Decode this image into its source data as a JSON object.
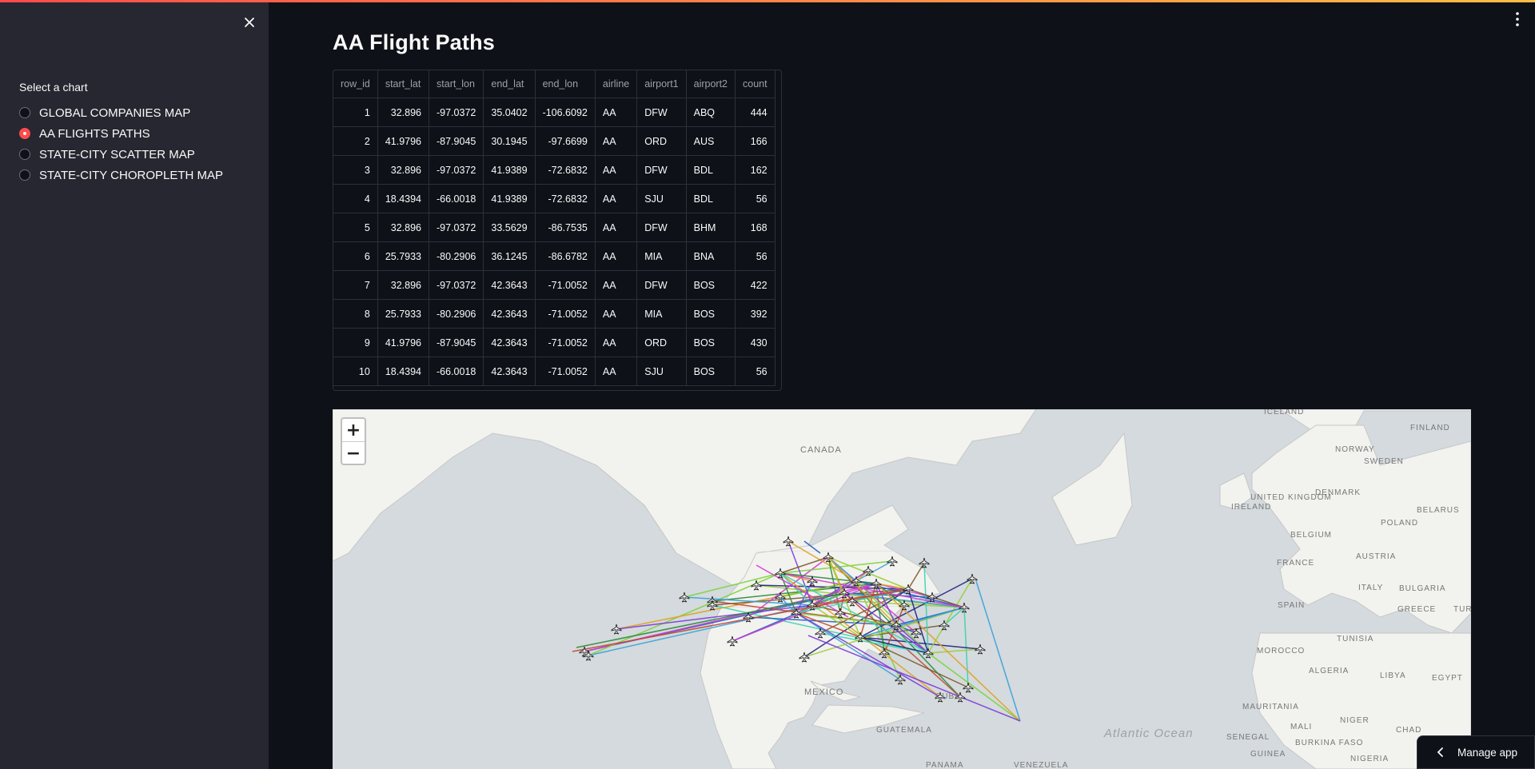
{
  "sidebar": {
    "close_icon": "close-icon",
    "label": "Select a chart",
    "options": [
      "GLOBAL COMPANIES MAP",
      "AA FLIGHTS PATHS",
      "STATE-CITY SCATTER MAP",
      "STATE-CITY CHOROPLETH MAP"
    ],
    "selected": "AA FLIGHTS PATHS"
  },
  "main": {
    "menu_icon": "kebab-menu-icon",
    "title": "AA Flight Paths"
  },
  "table": {
    "columns": [
      "row_id",
      "start_lat",
      "start_lon",
      "end_lat",
      "end_lon",
      "airline",
      "airport1",
      "airport2",
      "count"
    ],
    "rows": [
      [
        "1",
        "32.896",
        "-97.0372",
        "35.0402",
        "-106.6092",
        "AA",
        "DFW",
        "ABQ",
        "444"
      ],
      [
        "2",
        "41.9796",
        "-87.9045",
        "30.1945",
        "-97.6699",
        "AA",
        "ORD",
        "AUS",
        "166"
      ],
      [
        "3",
        "32.896",
        "-97.0372",
        "41.9389",
        "-72.6832",
        "AA",
        "DFW",
        "BDL",
        "162"
      ],
      [
        "4",
        "18.4394",
        "-66.0018",
        "41.9389",
        "-72.6832",
        "AA",
        "SJU",
        "BDL",
        "56"
      ],
      [
        "5",
        "32.896",
        "-97.0372",
        "33.5629",
        "-86.7535",
        "AA",
        "DFW",
        "BHM",
        "168"
      ],
      [
        "6",
        "25.7933",
        "-80.2906",
        "36.1245",
        "-86.6782",
        "AA",
        "MIA",
        "BNA",
        "56"
      ],
      [
        "7",
        "32.896",
        "-97.0372",
        "42.3643",
        "-71.0052",
        "AA",
        "DFW",
        "BOS",
        "422"
      ],
      [
        "8",
        "25.7933",
        "-80.2906",
        "42.3643",
        "-71.0052",
        "AA",
        "MIA",
        "BOS",
        "392"
      ],
      [
        "9",
        "41.9796",
        "-87.9045",
        "42.3643",
        "-71.0052",
        "AA",
        "ORD",
        "BOS",
        "430"
      ],
      [
        "10",
        "18.4394",
        "-66.0018",
        "42.3643",
        "-71.0052",
        "AA",
        "SJU",
        "BOS",
        "56"
      ]
    ]
  },
  "map": {
    "zoom_in": "+",
    "zoom_out": "−",
    "labels": {
      "canada": "CANADA",
      "mexico": "MEXICO",
      "cuba": "CUBA",
      "guatemala": "GUATEMALA",
      "panama": "PANAMA",
      "venezuela": "VENEZUELA",
      "iceland": "ICELAND",
      "finland": "FINLAND",
      "norway": "NORWAY",
      "sweden": "SWEDEN",
      "uk": "UNITED KINGDOM",
      "ireland": "IRELAND",
      "denmark": "DENMARK",
      "belarus": "BELARUS",
      "poland": "POLAND",
      "belgium": "BELGIUM",
      "france": "FRANCE",
      "austria": "AUSTRIA",
      "italy": "ITALY",
      "bulgaria": "BULGARIA",
      "spain": "SPAIN",
      "greece": "GREECE",
      "tur": "TUR",
      "morocco": "MOROCCO",
      "tunisia": "TUNISIA",
      "algeria": "ALGERIA",
      "libya": "LIBYA",
      "egypt": "EGYPT",
      "mauritania": "MAURITANIA",
      "mali": "MALI",
      "niger": "NIGER",
      "chad": "CHAD",
      "senegal": "SENEGAL",
      "guinea": "GUINEA",
      "burkina": "BURKINA FASO",
      "nigeria": "NIGERIA",
      "atlantic": "Atlantic Ocean"
    },
    "airport_icon": "airplane-icon",
    "line_colors": [
      "#1f5fbf",
      "#d13ad1",
      "#3aa0d9",
      "#7bd13a",
      "#e0a020",
      "#7a3ad9",
      "#2a8a3a",
      "#c4452f",
      "#7a5a2a",
      "#3ad1b0",
      "#9acd32",
      "#202080"
    ]
  },
  "manage": {
    "chevron_icon": "chevron-left-icon",
    "label": "Manage app"
  }
}
